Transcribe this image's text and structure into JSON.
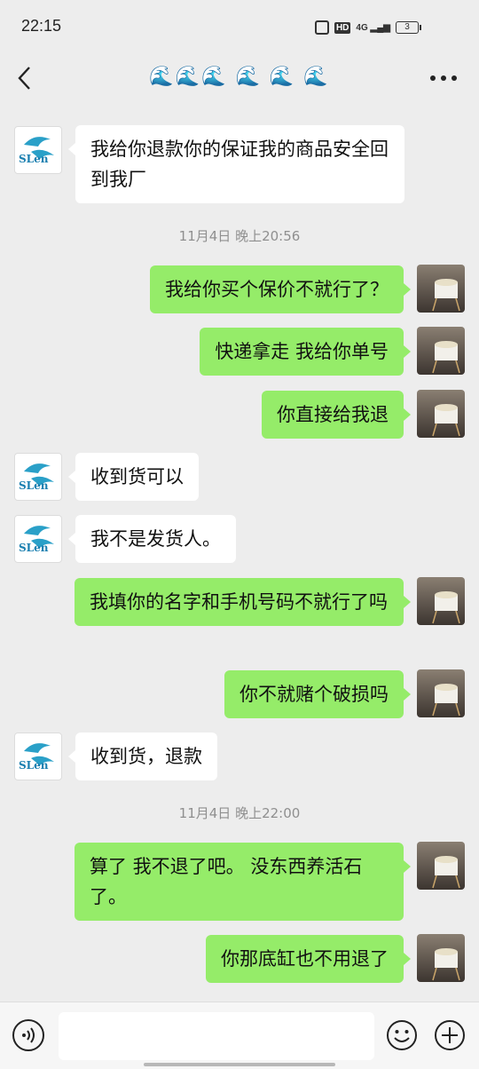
{
  "status_bar": {
    "time": "22:15",
    "network": "4G",
    "hd": "HD",
    "battery": "3"
  },
  "header": {
    "title": "🌊🌊🌊 🌊 🌊 🌊"
  },
  "messages": [
    {
      "side": "in",
      "text": "我给你退款你的保证我的商品安全回到我厂"
    },
    {
      "type": "timestamp",
      "text": "11月4日 晚上20:56"
    },
    {
      "side": "out",
      "text": "我给你买个保价不就行了？"
    },
    {
      "side": "out",
      "text": "快递拿走 我给你单号"
    },
    {
      "side": "out",
      "text": "你直接给我退"
    },
    {
      "side": "in",
      "text": "收到货可以"
    },
    {
      "side": "in",
      "text": "我不是发货人。"
    },
    {
      "side": "out",
      "text": "我填你的名字和手机号码不就行了吗"
    },
    {
      "side": "out",
      "text": "你不就赌个破损吗"
    },
    {
      "side": "in",
      "text": "收到货，退款"
    },
    {
      "type": "timestamp",
      "text": "11月4日 晚上22:00"
    },
    {
      "side": "out",
      "text": "算了 我不退了吧。 没东西养活石了。"
    },
    {
      "side": "out",
      "text": "你那底缸也不用退了"
    }
  ],
  "contact_avatar_text": "SLen",
  "input": {
    "value": ""
  }
}
